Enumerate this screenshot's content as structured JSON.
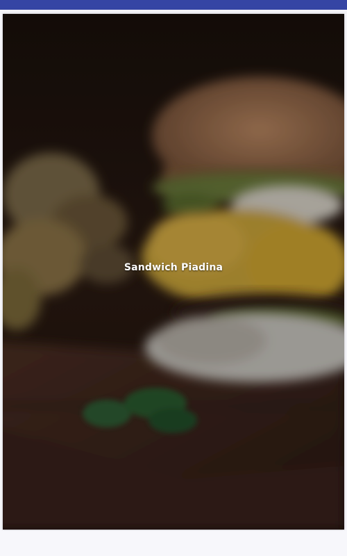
{
  "status_bar": {
    "color": "#3545a4"
  },
  "category_card": {
    "title": "Sandwich Piadina",
    "image_icon": "burger-photo"
  }
}
